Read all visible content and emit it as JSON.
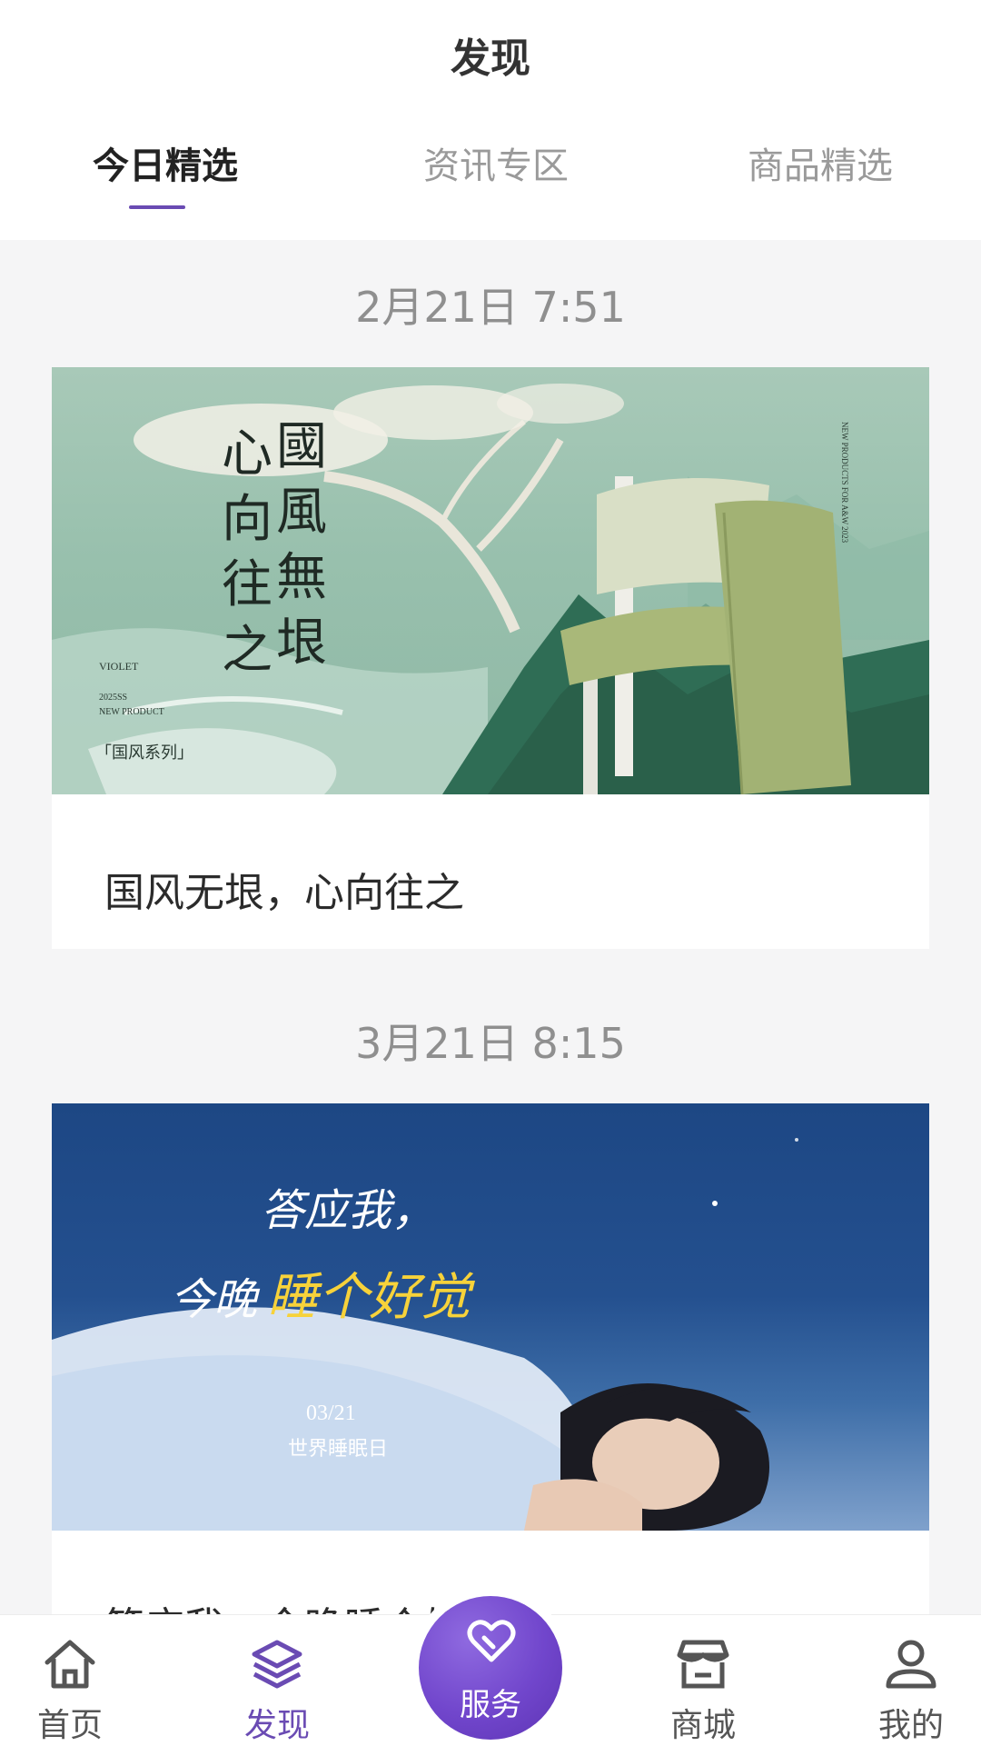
{
  "header": {
    "title": "发现"
  },
  "tabs": [
    {
      "label": "今日精选",
      "active": true
    },
    {
      "label": "资讯专区",
      "active": false
    },
    {
      "label": "商品精选",
      "active": false
    }
  ],
  "feed": [
    {
      "date": "2月21日 7:51",
      "image": {
        "vertical_text_left": [
          "心",
          "向",
          "往",
          "之"
        ],
        "vertical_text_right": [
          "國",
          "風",
          "無",
          "垠"
        ],
        "brand": "VIOLET",
        "series_code": "2025SS",
        "new_product": "NEW PRODUCT",
        "series_tag": "「国风系列」",
        "side_text": "NEW PRODUCTS FOR A&W 2023"
      },
      "caption": "国风无垠，心向往之"
    },
    {
      "date": "3月21日 8:15",
      "image": {
        "line1": "答应我，",
        "line2_white": "今晚",
        "line2_yellow": "睡个好觉",
        "date_text": "03/21",
        "event": "世界睡眠日"
      },
      "caption": "答应我，今晚睡个好觉"
    }
  ],
  "bottom_nav": {
    "items": [
      {
        "label": "首页",
        "icon": "home-icon",
        "active": false
      },
      {
        "label": "发现",
        "icon": "layers-icon",
        "active": true
      },
      {
        "label": "商城",
        "icon": "store-icon",
        "active": false
      },
      {
        "label": "我的",
        "icon": "user-icon",
        "active": false
      }
    ],
    "center": {
      "label": "服务",
      "icon": "heart-icon"
    }
  },
  "colors": {
    "accent": "#6a4bb3",
    "background": "#f5f5f6"
  }
}
